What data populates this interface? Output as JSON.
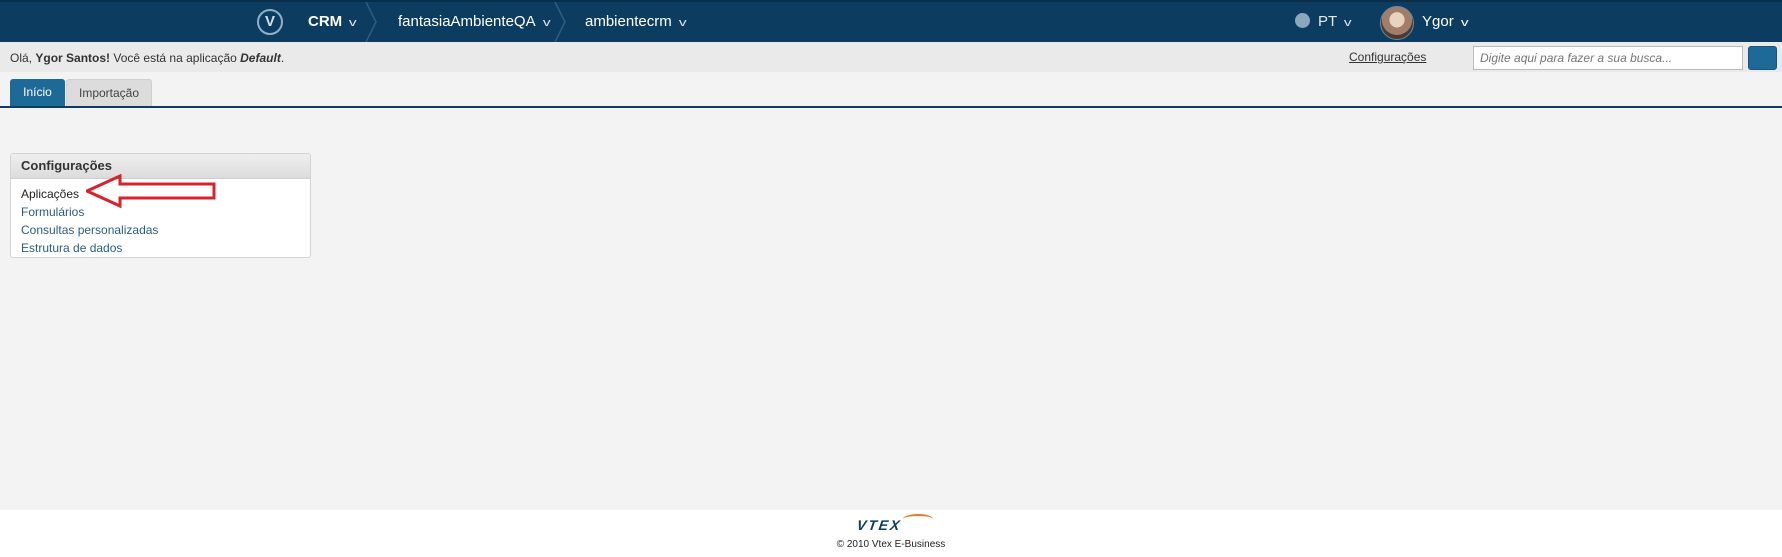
{
  "topnav": {
    "app": "CRM",
    "account": "fantasiaAmbienteQA",
    "environment": "ambientecrm",
    "language": "PT",
    "user": "Ygor",
    "logo_icon": "vtex-v-icon",
    "dropdown_icon": "chevron-down-icon"
  },
  "greeting": {
    "prefix": "Olá,",
    "name": "Ygor Santos!",
    "middle": "Você está na aplicação",
    "app": "Default",
    "suffix": "."
  },
  "header_links": {
    "configuracoes": "Configurações"
  },
  "search": {
    "placeholder": "Digite aqui para fazer a sua busca..."
  },
  "tabs": [
    {
      "label": "Início",
      "active": true
    },
    {
      "label": "Importação",
      "active": false
    }
  ],
  "panel": {
    "title": "Configurações",
    "items": [
      "Aplicações",
      "Formulários",
      "Consultas personalizadas",
      "Estrutura de dados"
    ]
  },
  "annotation": {
    "color": "#d9232a"
  },
  "footer": {
    "logo": "VTEX",
    "copyright": "© 2010 Vtex E-Business"
  },
  "colors": {
    "topbar": "#0c3d61",
    "accent": "#1d6a99",
    "link": "#2a5c84"
  }
}
